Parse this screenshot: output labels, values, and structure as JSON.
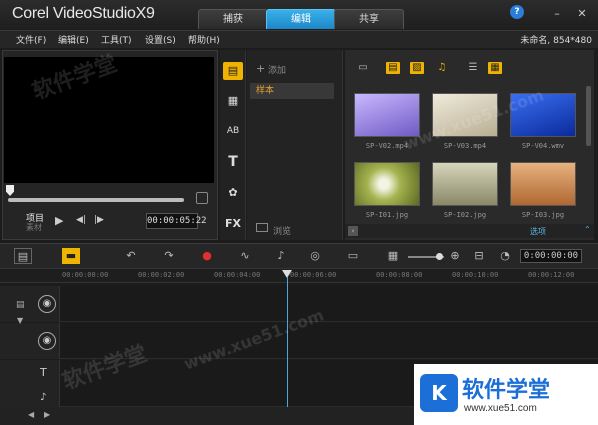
{
  "app": {
    "title": "Corel VideoStudioX9",
    "project_info": "未命名, 854*480",
    "help": "?"
  },
  "tabs": [
    {
      "label": "捕获",
      "active": false
    },
    {
      "label": "编辑",
      "active": true
    },
    {
      "label": "共享",
      "active": false
    }
  ],
  "window_controls": {
    "minimize": "–",
    "close": "✕"
  },
  "menu": [
    "文件(F)",
    "编辑(E)",
    "工具(T)",
    "设置(S)",
    "帮助(H)"
  ],
  "player": {
    "mode_project": "项目",
    "mode_clip": "素材",
    "timecode": "00:00:05:22",
    "play_icon": "▶",
    "prev_icon": "◀|",
    "next_icon": "|▶"
  },
  "library": {
    "side_icons": [
      "media-icon",
      "instant-project-icon",
      "transition-icon",
      "title-icon",
      "graphic-icon",
      "filter-icon"
    ],
    "side_glyphs": [
      "▤",
      "▦",
      "AB",
      "T",
      "✿",
      "FX"
    ],
    "add_label": "添加",
    "folders": [
      "样本"
    ],
    "browse_label": "浏览",
    "options_label": "选项",
    "thumbs": [
      {
        "caption": "SP-V02.mp4",
        "color": "#9a8ad8"
      },
      {
        "caption": "SP-V03.mp4",
        "color": "#d9d2bf"
      },
      {
        "caption": "SP-V04.wmv",
        "color": "#1f4fc8"
      },
      {
        "caption": "SP-I01.jpg",
        "color": "#9cab4a"
      },
      {
        "caption": "SP-I02.jpg",
        "color": "#b7b48e"
      },
      {
        "caption": "SP-I03.jpg",
        "color": "#c98a4c"
      }
    ]
  },
  "timeline": {
    "timecode": "0:00:00:00",
    "ticks": [
      "00:00:00:00",
      "00:00:02:00",
      "00:00:04:00",
      "00:00:06:00",
      "00:00:08:00",
      "00:00:10:00",
      "00:00:12:00"
    ],
    "tracks": [
      "video-track",
      "overlay-track",
      "title-track",
      "voice-track"
    ],
    "track_glyphs": [
      "◉",
      "◉",
      "T",
      "♪"
    ]
  },
  "watermark": {
    "title": "软件学堂",
    "url": "www.xue51.com",
    "logo": "K",
    "overlay_text": "软件学堂",
    "overlay_url": "www.xue51.com"
  },
  "colors": {
    "accent": "#2aa3e6",
    "library_active": "#f0b400",
    "playhead": "#4aa8e0"
  }
}
